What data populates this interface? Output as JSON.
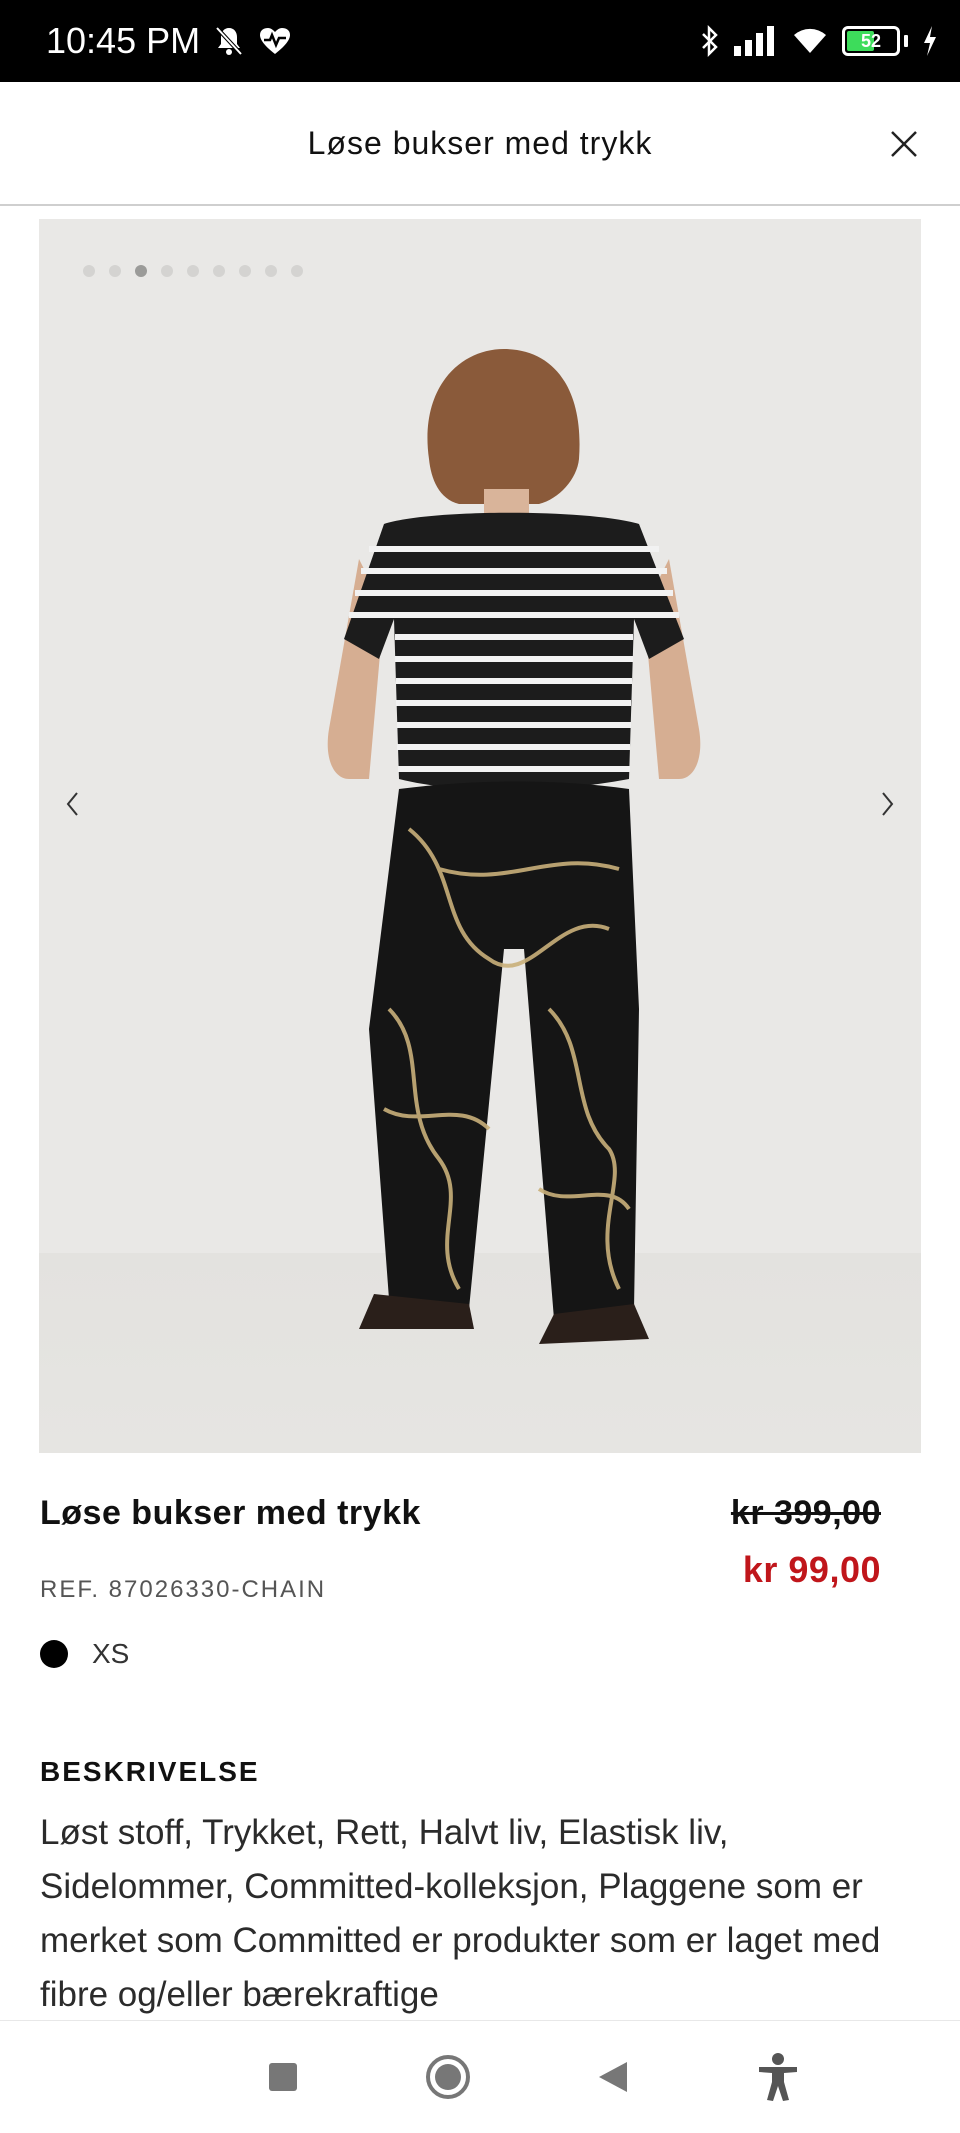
{
  "status_bar": {
    "time": "10:45 PM",
    "battery_level": "52"
  },
  "header": {
    "title": "Løse bukser med trykk"
  },
  "gallery": {
    "total_images": 9,
    "active_index": 2
  },
  "product": {
    "name": "Løse bukser med trykk",
    "price_original": "kr 399,00",
    "price_sale": "kr 99,00",
    "ref": "REF. 87026330-CHAIN",
    "selected_color": "#000000",
    "size": "XS"
  },
  "description": {
    "title": "BESKRIVELSE",
    "text": "Løst stoff, Trykket, Rett, Halvt liv, Elastisk liv, Sidelommer, Committed-kolleksjon, Plaggene som er merket som Committed er produkter som er laget med fibre og/eller bærekraftige"
  },
  "colors": {
    "sale_price": "#c0161b",
    "status_bar_bg": "#000000"
  }
}
